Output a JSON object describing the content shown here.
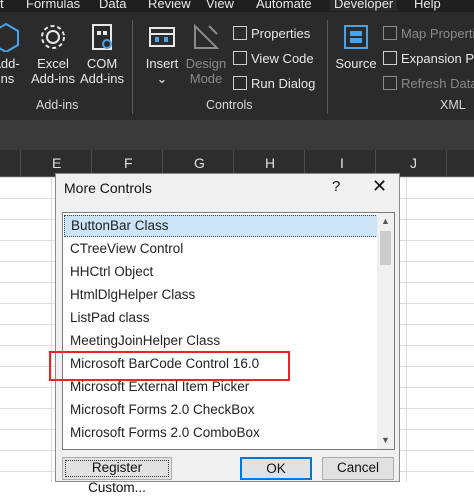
{
  "menubar": {
    "tabs": [
      "Formulas",
      "Data",
      "Review",
      "View",
      "Automate",
      "Developer",
      "Help"
    ],
    "partial_first": "t"
  },
  "ribbon": {
    "addins": {
      "partial_button": "Add-\nins",
      "excel_addins": "Excel\nAdd-ins",
      "com_addins": "COM\nAdd-ins",
      "group_label": "Add-ins"
    },
    "controls": {
      "insert": "Insert",
      "design_mode": "Design\nMode",
      "properties": "Properties",
      "view_code": "View Code",
      "run_dialog": "Run Dialog",
      "group_label": "Controls"
    },
    "xml": {
      "source": "Source",
      "map_properties": "Map Properties",
      "expansion_packs": "Expansion Pac",
      "refresh_data": "Refresh Data",
      "group_label": "XML"
    }
  },
  "columns": [
    "E",
    "F",
    "G",
    "H",
    "I",
    "J"
  ],
  "dialog": {
    "title": "More Controls",
    "help": "?",
    "close": "✕",
    "items": [
      "ButtonBar Class",
      "CTreeView Control",
      "HHCtrl Object",
      "HtmlDlgHelper Class",
      "ListPad class",
      "MeetingJoinHelper Class",
      "Microsoft BarCode Control 16.0",
      "Microsoft External Item Picker",
      "Microsoft Forms 2.0 CheckBox",
      "Microsoft Forms 2.0 ComboBox"
    ],
    "selected_index": 0,
    "highlighted_item": "Microsoft BarCode Control 16.0",
    "register_custom": "Register Custom...",
    "ok": "OK",
    "cancel": "Cancel"
  }
}
